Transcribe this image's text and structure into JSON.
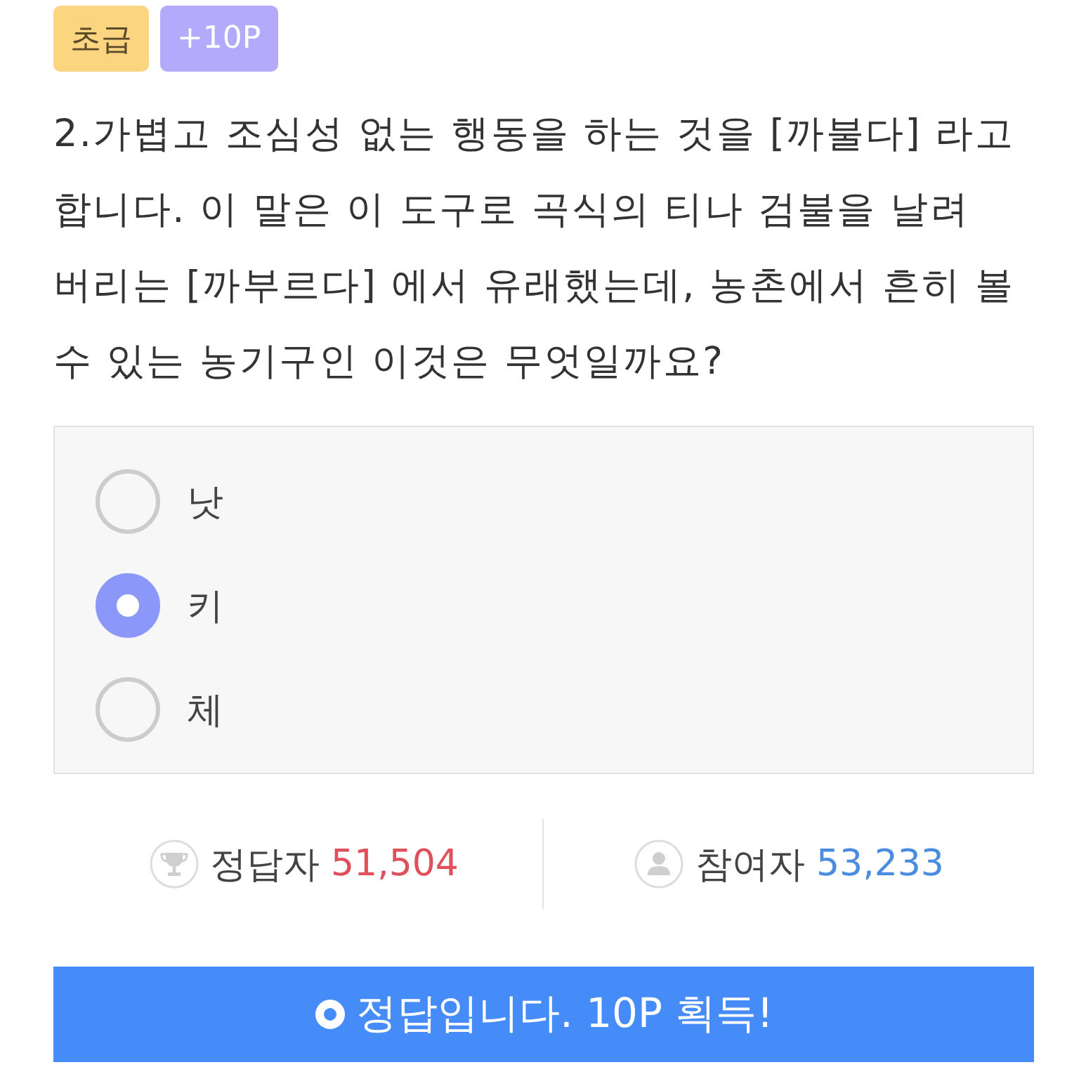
{
  "badges": [
    {
      "label": "초급",
      "kind": "level"
    },
    {
      "label": "+10P",
      "kind": "points"
    }
  ],
  "question": "2.가볍고 조심성 없는 행동을 하는 것을 [까불다] 라고 합니다. 이 말은 이 도구로 곡식의 티나 검불을 날려 버리는 [까부르다] 에서 유래했는데, 농촌에서 흔히 볼 수 있는 농기구인 이것은 무엇일까요?",
  "options": [
    {
      "label": "낫",
      "selected": false
    },
    {
      "label": "키",
      "selected": true
    },
    {
      "label": "체",
      "selected": false
    }
  ],
  "stats": [
    {
      "kind": "correct",
      "label": "정답자",
      "value": "51,504"
    },
    {
      "kind": "participants",
      "label": "참여자",
      "value": "53,233"
    }
  ],
  "result_button": {
    "label": "정답입니다. 10P 획득!"
  }
}
